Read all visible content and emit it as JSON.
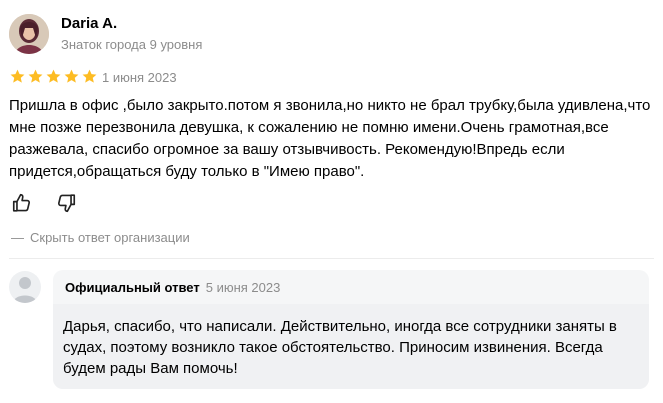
{
  "review": {
    "author": {
      "name": "Daria A.",
      "level": "Знаток города 9 уровня"
    },
    "rating": {
      "stars": 5,
      "max": 5,
      "color": "#fdbc23"
    },
    "date": "1 июня 2023",
    "text": "Пришла в офис ,было закрыто.потом я звонила,но никто не брал трубку,была удивлена,что мне позже перезвонила девушка, к сожалению не помню имени.Очень грамотная,все разжевала, спасибо огромное за вашу отзывчивость. Рекомендую!Впредь если придется,обращаться буду только в \"Имею право\".",
    "actions": {
      "like_icon": "thumbs-up-icon",
      "dislike_icon": "thumbs-down-icon"
    },
    "toggle_answer": {
      "dash": "—",
      "label": "Скрыть ответ организации"
    }
  },
  "official_answer": {
    "title": "Официальный ответ",
    "date": "5 июня 2023",
    "text": "Дарья, спасибо, что написали. Действительно, иногда все сотрудники заняты в судах, поэтому возникло такое обстоятельство. Приносим извинения. Всегда будем рады Вам помочь!"
  }
}
